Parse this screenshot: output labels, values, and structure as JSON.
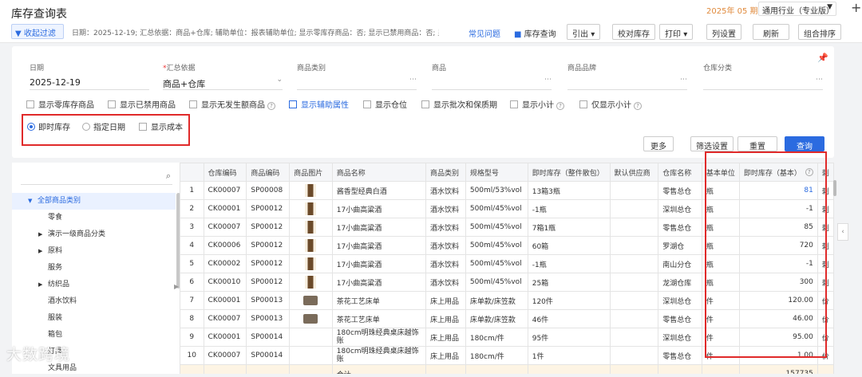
{
  "header": {
    "title": "库存查询表",
    "period": "2025年 05 期",
    "industry": "通用行业（专业版）"
  },
  "toolbar": {
    "collapse_label": "收起过滤",
    "crumb": "日期：2025-12-19; 汇总依据：商品+仓库; 辅助单位：报表辅助单位; 显示零库存商品：否; 显示已禁用商品：否; 显示辅...",
    "faq": "常见问题",
    "inventory_video": "库存查询",
    "export": "引出",
    "check_stock": "校对库存",
    "print": "打印",
    "column_settings": "列设置",
    "refresh": "刷新",
    "combine_sort": "组合排序"
  },
  "filters": {
    "date_label": "日期",
    "date_value": "2025-12-19",
    "group_label": "汇总依据",
    "group_value": "商品+仓库",
    "category_label": "商品类别",
    "product_label": "商品",
    "brand_label": "商品品牌",
    "warehouse_cat_label": "仓库分类",
    "checks": [
      "显示零库存商品",
      "显示已禁用商品",
      "显示无发生额商品",
      "显示辅助属性",
      "显示仓位",
      "显示批次和保质期",
      "显示小计",
      "仅显示小计"
    ],
    "radio_realtime": "即时库存",
    "radio_date": "指定日期",
    "show_cost": "显示成本",
    "more": "更多",
    "filter_settings": "筛选设置",
    "reset": "重置",
    "query": "查询"
  },
  "tree": {
    "nodes": [
      {
        "label": "全部商品类别",
        "arrow": "▼"
      },
      {
        "label": "零食",
        "arrow": ""
      },
      {
        "label": "演示一级商品分类",
        "arrow": "▶"
      },
      {
        "label": "原料",
        "arrow": "▶"
      },
      {
        "label": "服务",
        "arrow": ""
      },
      {
        "label": "纺织品",
        "arrow": "▶"
      },
      {
        "label": "酒水饮料",
        "arrow": ""
      },
      {
        "label": "服装",
        "arrow": ""
      },
      {
        "label": "箱包",
        "arrow": ""
      },
      {
        "label": "灯具",
        "arrow": ""
      },
      {
        "label": "文具用品",
        "arrow": ""
      }
    ]
  },
  "table": {
    "headers": [
      "",
      "仓库编码",
      "商品编码",
      "商品图片",
      "商品名称",
      "商品类别",
      "规格型号",
      "即时库存（整件散包）",
      "默认供应商",
      "仓库名称",
      "基本单位",
      "即时库存（基本）",
      "刺"
    ],
    "rows": [
      {
        "no": "1",
        "wh_code": "CK00007",
        "sku": "SP00008",
        "img": "bottle",
        "name": "酱香型经典白酒",
        "cat": "酒水饮料",
        "spec": "500ml/53%vol",
        "pack": "13箱3瓶",
        "supplier": "",
        "wh": "零售总仓",
        "unit": "瓶",
        "qty": "81",
        "blue": true,
        "last": "刺"
      },
      {
        "no": "2",
        "wh_code": "CK00001",
        "sku": "SP00012",
        "img": "bottle",
        "name": "17小曲高粱酒",
        "cat": "酒水饮料",
        "spec": "500ml/45%vol",
        "pack": "-1瓶",
        "supplier": "",
        "wh": "深圳总仓",
        "unit": "瓶",
        "qty": "-1",
        "blue": false,
        "last": "刺"
      },
      {
        "no": "3",
        "wh_code": "CK00007",
        "sku": "SP00012",
        "img": "bottle",
        "name": "17小曲高粱酒",
        "cat": "酒水饮料",
        "spec": "500ml/45%vol",
        "pack": "7箱1瓶",
        "supplier": "",
        "wh": "零售总仓",
        "unit": "瓶",
        "qty": "85",
        "blue": false,
        "last": "刺"
      },
      {
        "no": "4",
        "wh_code": "CK00006",
        "sku": "SP00012",
        "img": "bottle",
        "name": "17小曲高粱酒",
        "cat": "酒水饮料",
        "spec": "500ml/45%vol",
        "pack": "60箱",
        "supplier": "",
        "wh": "罗湖仓",
        "unit": "瓶",
        "qty": "720",
        "blue": false,
        "last": "刺"
      },
      {
        "no": "5",
        "wh_code": "CK00002",
        "sku": "SP00012",
        "img": "bottle",
        "name": "17小曲高粱酒",
        "cat": "酒水饮料",
        "spec": "500ml/45%vol",
        "pack": "-1瓶",
        "supplier": "",
        "wh": "南山分仓",
        "unit": "瓶",
        "qty": "-1",
        "blue": false,
        "last": "刺"
      },
      {
        "no": "6",
        "wh_code": "CK00010",
        "sku": "SP00012",
        "img": "bottle",
        "name": "17小曲高粱酒",
        "cat": "酒水饮料",
        "spec": "500ml/45%vol",
        "pack": "25箱",
        "supplier": "",
        "wh": "龙湖仓库",
        "unit": "瓶",
        "qty": "300",
        "blue": false,
        "last": "刺"
      },
      {
        "no": "7",
        "wh_code": "CK00001",
        "sku": "SP00013",
        "img": "cloth",
        "name": "茶花工艺床单",
        "cat": "床上用品",
        "spec": "床单款/床笠款",
        "pack": "120件",
        "supplier": "",
        "wh": "深圳总仓",
        "unit": "件",
        "qty": "120.00",
        "blue": false,
        "last": "价"
      },
      {
        "no": "8",
        "wh_code": "CK00007",
        "sku": "SP00013",
        "img": "cloth",
        "name": "茶花工艺床单",
        "cat": "床上用品",
        "spec": "床单款/床笠款",
        "pack": "46件",
        "supplier": "",
        "wh": "零售总仓",
        "unit": "件",
        "qty": "46.00",
        "blue": false,
        "last": "价"
      },
      {
        "no": "9",
        "wh_code": "CK00001",
        "sku": "SP00014",
        "img": "",
        "name": "180cm明珠经典桌床越饰账",
        "cat": "床上用品",
        "spec": "180cm/件",
        "pack": "95件",
        "supplier": "",
        "wh": "深圳总仓",
        "unit": "件",
        "qty": "95.00",
        "blue": false,
        "last": "价"
      },
      {
        "no": "10",
        "wh_code": "CK00007",
        "sku": "SP00014",
        "img": "",
        "name": "180cm明珠经典桌床越饰账",
        "cat": "床上用品",
        "spec": "180cm/件",
        "pack": "1件",
        "supplier": "",
        "wh": "零售总仓",
        "unit": "件",
        "qty": "1.00",
        "blue": false,
        "last": "价"
      }
    ],
    "total_label": "合计",
    "total_qty": "157735"
  },
  "watermark": "大数跨境"
}
